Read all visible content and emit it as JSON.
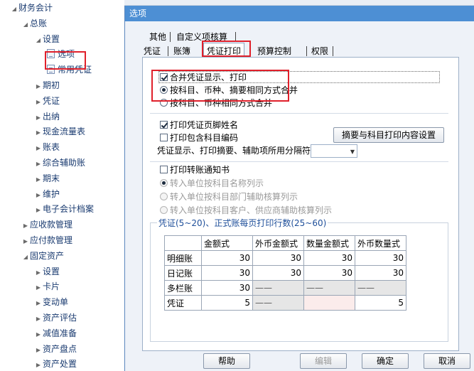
{
  "tree": {
    "items": [
      {
        "label": "财务会计",
        "arrow": "◢"
      },
      {
        "label": "总账",
        "arrow": "◢"
      },
      {
        "label": "设置",
        "arrow": "◢"
      },
      {
        "label": "选项",
        "arrow": ""
      },
      {
        "label": "常用凭证",
        "arrow": ""
      },
      {
        "label": "期初",
        "arrow": "▶"
      },
      {
        "label": "凭证",
        "arrow": "▶"
      },
      {
        "label": "出纳",
        "arrow": "▶"
      },
      {
        "label": "现金流量表",
        "arrow": "▶"
      },
      {
        "label": "账表",
        "arrow": "▶"
      },
      {
        "label": "综合辅助账",
        "arrow": "▶"
      },
      {
        "label": "期末",
        "arrow": "▶"
      },
      {
        "label": "维护",
        "arrow": "▶"
      },
      {
        "label": "电子会计档案",
        "arrow": "▶"
      },
      {
        "label": "应收款管理",
        "arrow": "▶"
      },
      {
        "label": "应付款管理",
        "arrow": "▶"
      },
      {
        "label": "固定资产",
        "arrow": "◢"
      },
      {
        "label": "设置",
        "arrow": "▶"
      },
      {
        "label": "卡片",
        "arrow": "▶"
      },
      {
        "label": "变动单",
        "arrow": "▶"
      },
      {
        "label": "资产评估",
        "arrow": "▶"
      },
      {
        "label": "减值准备",
        "arrow": "▶"
      },
      {
        "label": "资产盘点",
        "arrow": "▶"
      },
      {
        "label": "资产处置",
        "arrow": "▶"
      }
    ]
  },
  "dialog": {
    "title": "选项",
    "tabs_top": [
      "其他",
      "自定义项核算"
    ],
    "tabs_bottom": [
      "凭证",
      "账簿",
      "凭证打印",
      "预算控制",
      "权限"
    ],
    "active_tab": "凭证打印",
    "merge_print_label": "合并凭证显示、打印",
    "merge_print_checked": true,
    "radio_same_label": "按科目、币种、摘要相同方式合并",
    "radio_same_selected": true,
    "radio_currency_label": "按科目、币种相同方式合并",
    "print_footer_label": "打印凭证页脚姓名",
    "print_footer_checked": true,
    "print_code_label": "打印包含科目编码",
    "print_code_checked": false,
    "summary_button": "摘要与科目打印内容设置",
    "separator_label": "凭证显示、打印摘要、辅助项所用分隔符",
    "separator_value": "",
    "transfer_label": "打印转账通知书",
    "transfer_checked": false,
    "transfer_options": [
      "转入单位按科目名称列示",
      "转入单位按科目部门辅助核算列示",
      "转入单位按科目客户、供应商辅助核算列示"
    ],
    "lines_legend": "凭证(5~20)、正式账每页打印行数(25~60)",
    "grid": {
      "headers": [
        "",
        "金额式",
        "外币金额式",
        "数量金额式",
        "外币数量式"
      ],
      "rows": [
        {
          "name": "明细账",
          "cells": [
            "30",
            "30",
            "30",
            "30"
          ]
        },
        {
          "name": "日记账",
          "cells": [
            "30",
            "30",
            "30",
            "30"
          ]
        },
        {
          "name": "多栏账",
          "cells": [
            "30",
            "——",
            "——",
            "——"
          ]
        },
        {
          "name": "凭证",
          "cells": [
            "5",
            "——",
            "",
            "5"
          ]
        }
      ]
    },
    "buttons": {
      "help": "帮助",
      "edit": "编辑",
      "ok": "确定",
      "cancel": "取消"
    }
  }
}
